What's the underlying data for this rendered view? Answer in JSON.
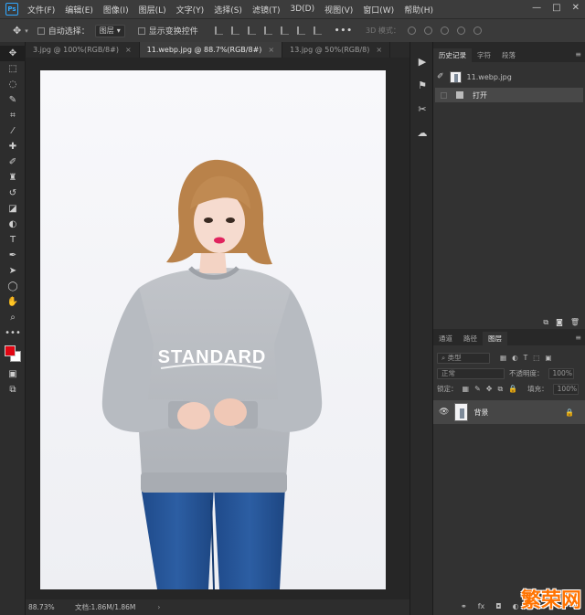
{
  "menubar": {
    "logo": "Ps",
    "items": [
      "文件(F)",
      "编辑(E)",
      "图像(I)",
      "图层(L)",
      "文字(Y)",
      "选择(S)",
      "滤镜(T)",
      "3D(D)",
      "视图(V)",
      "窗口(W)",
      "帮助(H)"
    ],
    "window_controls": [
      "—",
      "□",
      "✕"
    ]
  },
  "options": {
    "auto_select_label": "自动选择：",
    "auto_select_target": "图层",
    "show_transform_label": "显示变换控件",
    "more": "•••",
    "mode_3d": "3D 模式："
  },
  "tabs": [
    {
      "label": "3.jpg @ 100%(RGB/8#)",
      "active": false
    },
    {
      "label": "11.webp.jpg @ 88.7%(RGB/8#)",
      "active": true
    },
    {
      "label": "13.jpg @ 50%(RGB/8)",
      "active": false
    }
  ],
  "tab_close": "×",
  "sweatshirt_text": "STANDARD",
  "status": {
    "zoom": "88.73%",
    "doc_size": "文档:1.86M/1.86M",
    "arrow": "›"
  },
  "history_panel": {
    "tabs": [
      "历史记录",
      "字符",
      "段落"
    ],
    "snapshot_name": "11.webp.jpg",
    "states": [
      "打开"
    ]
  },
  "layers_panel": {
    "tabs": [
      "通道",
      "路径",
      "图层"
    ],
    "filter_kind": "类型",
    "blend_mode": "正常",
    "opacity_label": "不透明度：",
    "opacity_value": "100%",
    "lock_label": "锁定：",
    "fill_label": "填充：",
    "fill_value": "100%",
    "layers": [
      {
        "name": "背景",
        "visible": true,
        "locked": true
      }
    ]
  },
  "watermark": "繁荣网",
  "colors": {
    "foreground": "#e10613",
    "background": "#ffffff",
    "accent": "#31a8ff"
  }
}
